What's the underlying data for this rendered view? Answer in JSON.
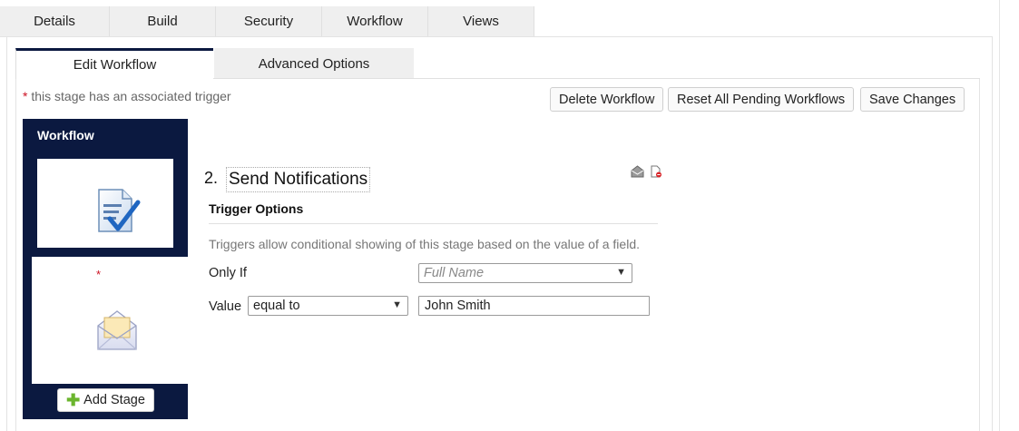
{
  "top_tabs": [
    {
      "label": "Details"
    },
    {
      "label": "Build"
    },
    {
      "label": "Security"
    },
    {
      "label": "Workflow"
    },
    {
      "label": "Views"
    }
  ],
  "sub_tabs": {
    "edit": "Edit Workflow",
    "advanced": "Advanced Options"
  },
  "note": {
    "star": "*",
    "text": " this stage has an associated trigger"
  },
  "toolbar": {
    "delete": "Delete Workflow",
    "reset": "Reset All Pending Workflows",
    "save": "Save Changes"
  },
  "workflow_panel": {
    "title": "Workflow",
    "stage2_marker": "*",
    "add_stage": "Add Stage"
  },
  "stage": {
    "number": "2.",
    "name": "Send Notifications"
  },
  "trigger": {
    "heading": "Trigger Options",
    "description": "Triggers allow conditional showing of this stage based on the value of a field.",
    "only_if_label": "Only If",
    "field_placeholder": "Full Name",
    "value_label": "Value",
    "operator": "equal to",
    "value": "John Smith"
  },
  "colors": {
    "navy": "#0b1940",
    "required": "#cc1122",
    "add": "#6bb52e"
  }
}
